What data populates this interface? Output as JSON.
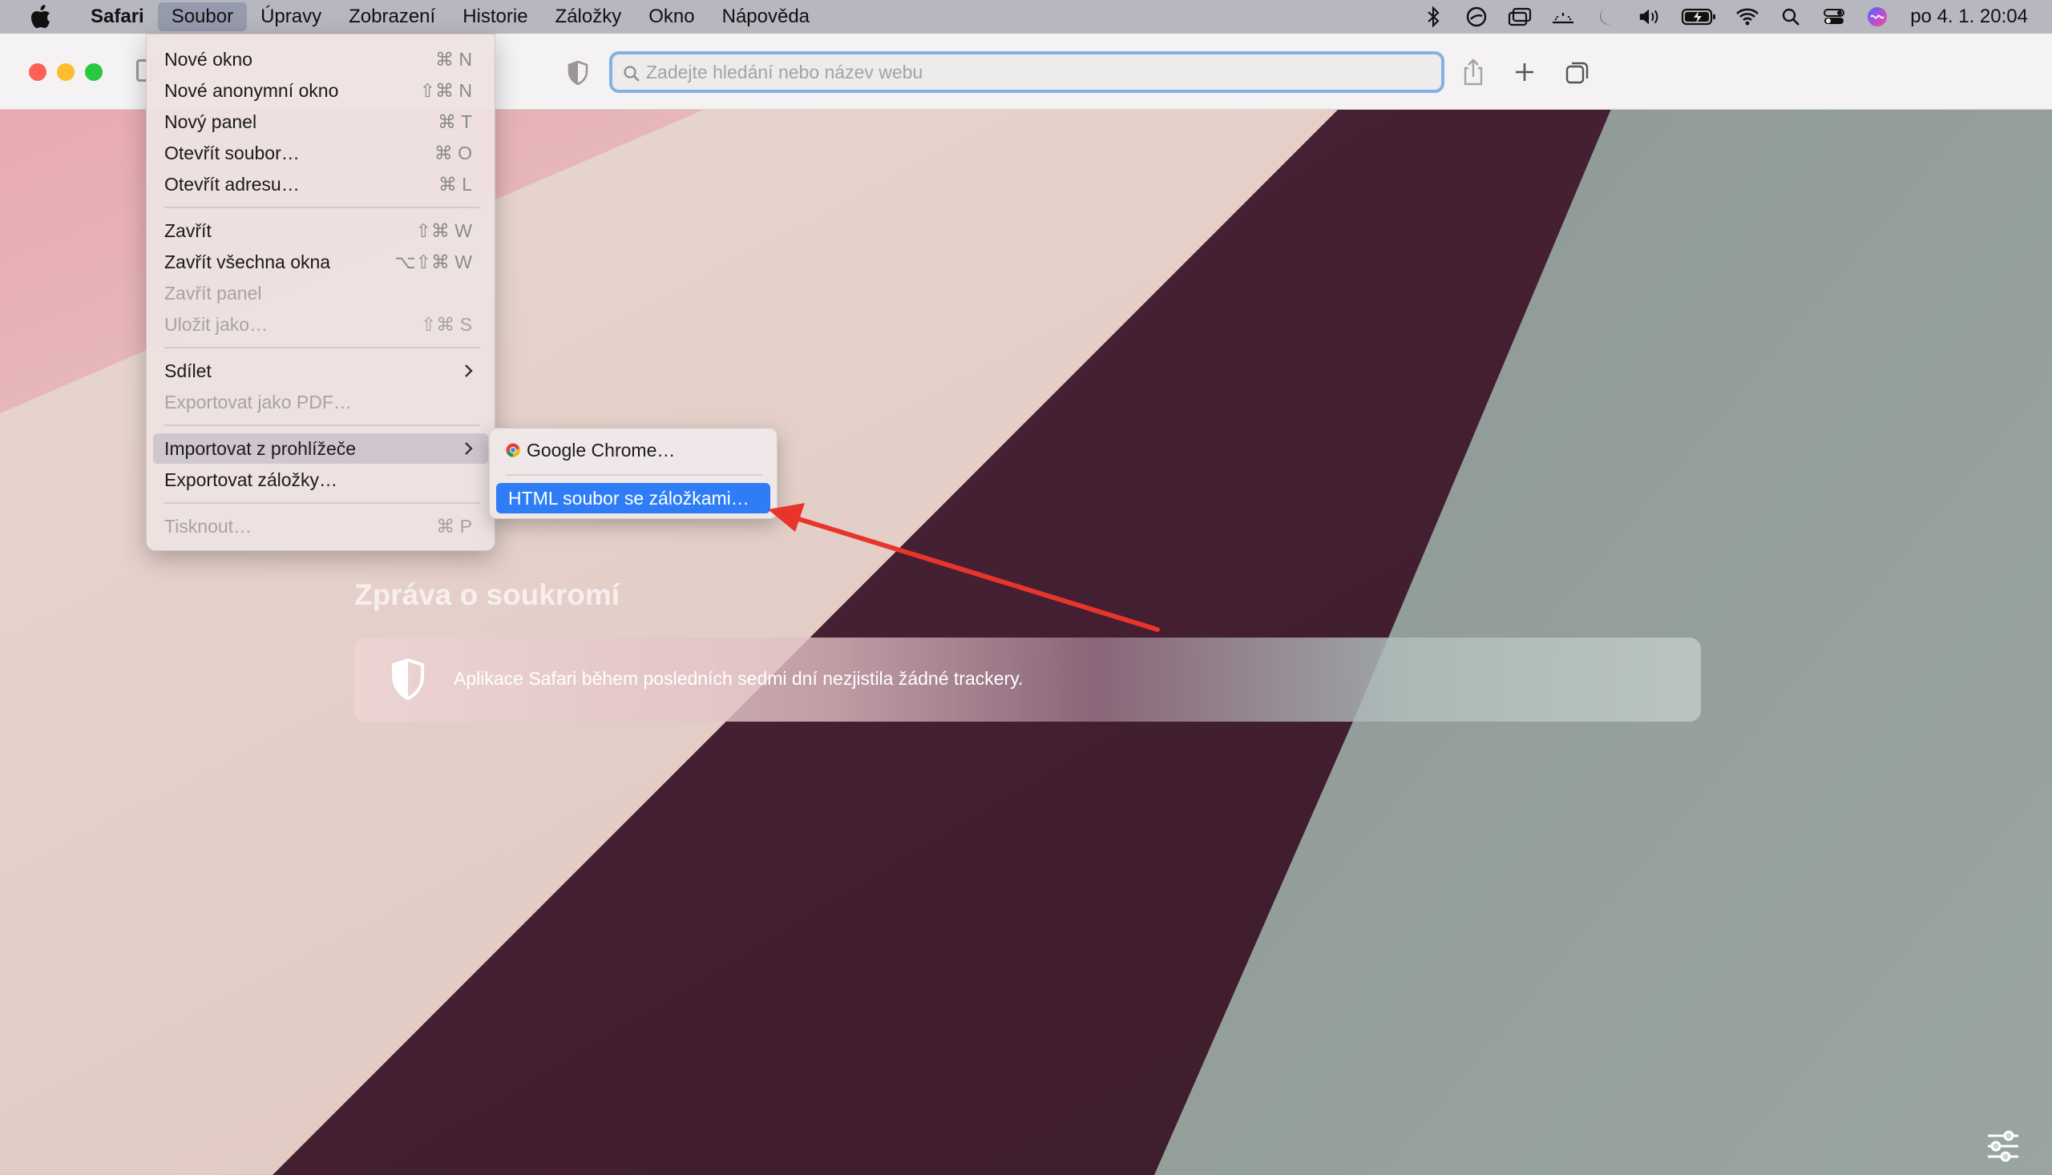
{
  "menubar": {
    "items": [
      "Safari",
      "Soubor",
      "Úpravy",
      "Zobrazení",
      "Historie",
      "Záložky",
      "Okno",
      "Nápověda"
    ],
    "status_icons": [
      "bluetooth-icon",
      "sync-icon",
      "screen-mirroring-icon",
      "activity-icon",
      "moon-icon",
      "volume-icon",
      "battery-icon",
      "wifi-icon",
      "spotlight-search-icon",
      "control-center-icon",
      "siri-icon"
    ],
    "clock": "po 4. 1.  20:04"
  },
  "toolbar": {
    "address_placeholder": "Zadejte hledání nebo název webu"
  },
  "file_menu": {
    "items": [
      {
        "label": "Nové okno",
        "shortcut": "⌘ N"
      },
      {
        "label": "Nové anonymní okno",
        "shortcut": "⇧⌘ N"
      },
      {
        "label": "Nový panel",
        "shortcut": "⌘ T"
      },
      {
        "label": "Otevřít soubor…",
        "shortcut": "⌘ O"
      },
      {
        "label": "Otevřít adresu…",
        "shortcut": "⌘ L"
      },
      {
        "label": "Zavřít",
        "shortcut": "⇧⌘ W"
      },
      {
        "label": "Zavřít všechna okna",
        "shortcut": "⌥⇧⌘ W"
      },
      {
        "label": "Zavřít panel",
        "shortcut": ""
      },
      {
        "label": "Uložit jako…",
        "shortcut": "⇧⌘ S"
      },
      {
        "label": "Sdílet",
        "shortcut": ""
      },
      {
        "label": "Exportovat jako PDF…",
        "shortcut": ""
      },
      {
        "label": "Importovat z prohlížeče",
        "shortcut": ""
      },
      {
        "label": "Exportovat záložky…",
        "shortcut": ""
      },
      {
        "label": "Tisknout…",
        "shortcut": "⌘ P"
      }
    ]
  },
  "import_submenu": {
    "items": [
      {
        "label": "Google Chrome…"
      },
      {
        "label": "HTML soubor se záložkami…"
      }
    ]
  },
  "privacy": {
    "title": "Zpráva o soukromí",
    "message": "Aplikace Safari během posledních sedmi dní nezjistila žádné trackery."
  },
  "colors": {
    "accent": "#2f7df6",
    "annotation_arrow": "#e8352b"
  }
}
